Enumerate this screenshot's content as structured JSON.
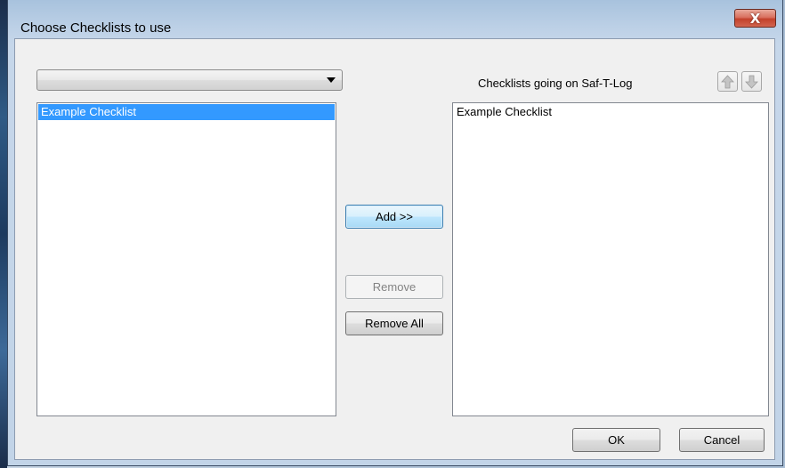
{
  "window": {
    "title": "Choose Checklists to use",
    "close_glyph": "X"
  },
  "left": {
    "combo_value": "",
    "items": [
      "Example Checklist"
    ]
  },
  "right": {
    "header": "Checklists going on Saf-T-Log",
    "items": [
      "Example Checklist"
    ]
  },
  "icons": {
    "move_up": "arrow-up-icon",
    "move_down": "arrow-down-icon",
    "dropdown": "chevron-down-icon"
  },
  "buttons": {
    "add": "Add >>",
    "remove": "Remove",
    "remove_all": "Remove All",
    "ok": "OK",
    "cancel": "Cancel"
  },
  "colors": {
    "selection": "#3399ff",
    "close_button": "#c3412b"
  }
}
